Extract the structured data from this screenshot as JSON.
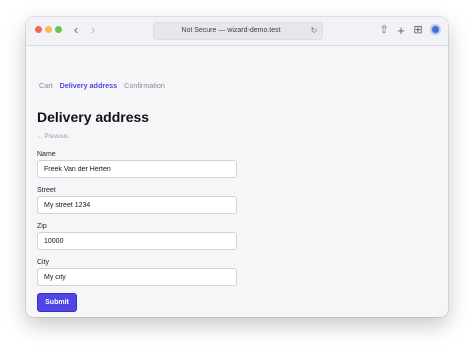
{
  "browser": {
    "url": "Not Secure — wizard-demo.test",
    "back_glyph": "‹",
    "forward_glyph": "›",
    "reload_glyph": "↻",
    "share_glyph": "⇧",
    "new_tab_glyph": "+",
    "tabs_glyph": "⊞",
    "icons": [
      "back-icon",
      "forward-icon",
      "reload-icon",
      "share-icon",
      "plus-icon",
      "tabs-overview-icon",
      "extension-icon"
    ],
    "traffic_lights": {
      "close": "#ed6a5e",
      "minimize": "#f5bf4f",
      "zoom": "#61c554"
    }
  },
  "breadcrumb": [
    {
      "label": "Cart",
      "active": false
    },
    {
      "label": "Delivery address",
      "active": true
    },
    {
      "label": "Confirmation",
      "active": false
    }
  ],
  "page": {
    "title": "Delivery address",
    "previous_link": "← Previous"
  },
  "form": {
    "name": {
      "label": "Name",
      "value": "Freek Van der Herten"
    },
    "street": {
      "label": "Street",
      "value": "My street 1234"
    },
    "zip": {
      "label": "Zip",
      "value": "10000"
    },
    "city": {
      "label": "City",
      "value": "My city"
    },
    "submit_label": "Submit"
  },
  "colors": {
    "accent": "#4f46e5",
    "muted_text": "#8a8992",
    "page_background": "#f6f6f9"
  }
}
